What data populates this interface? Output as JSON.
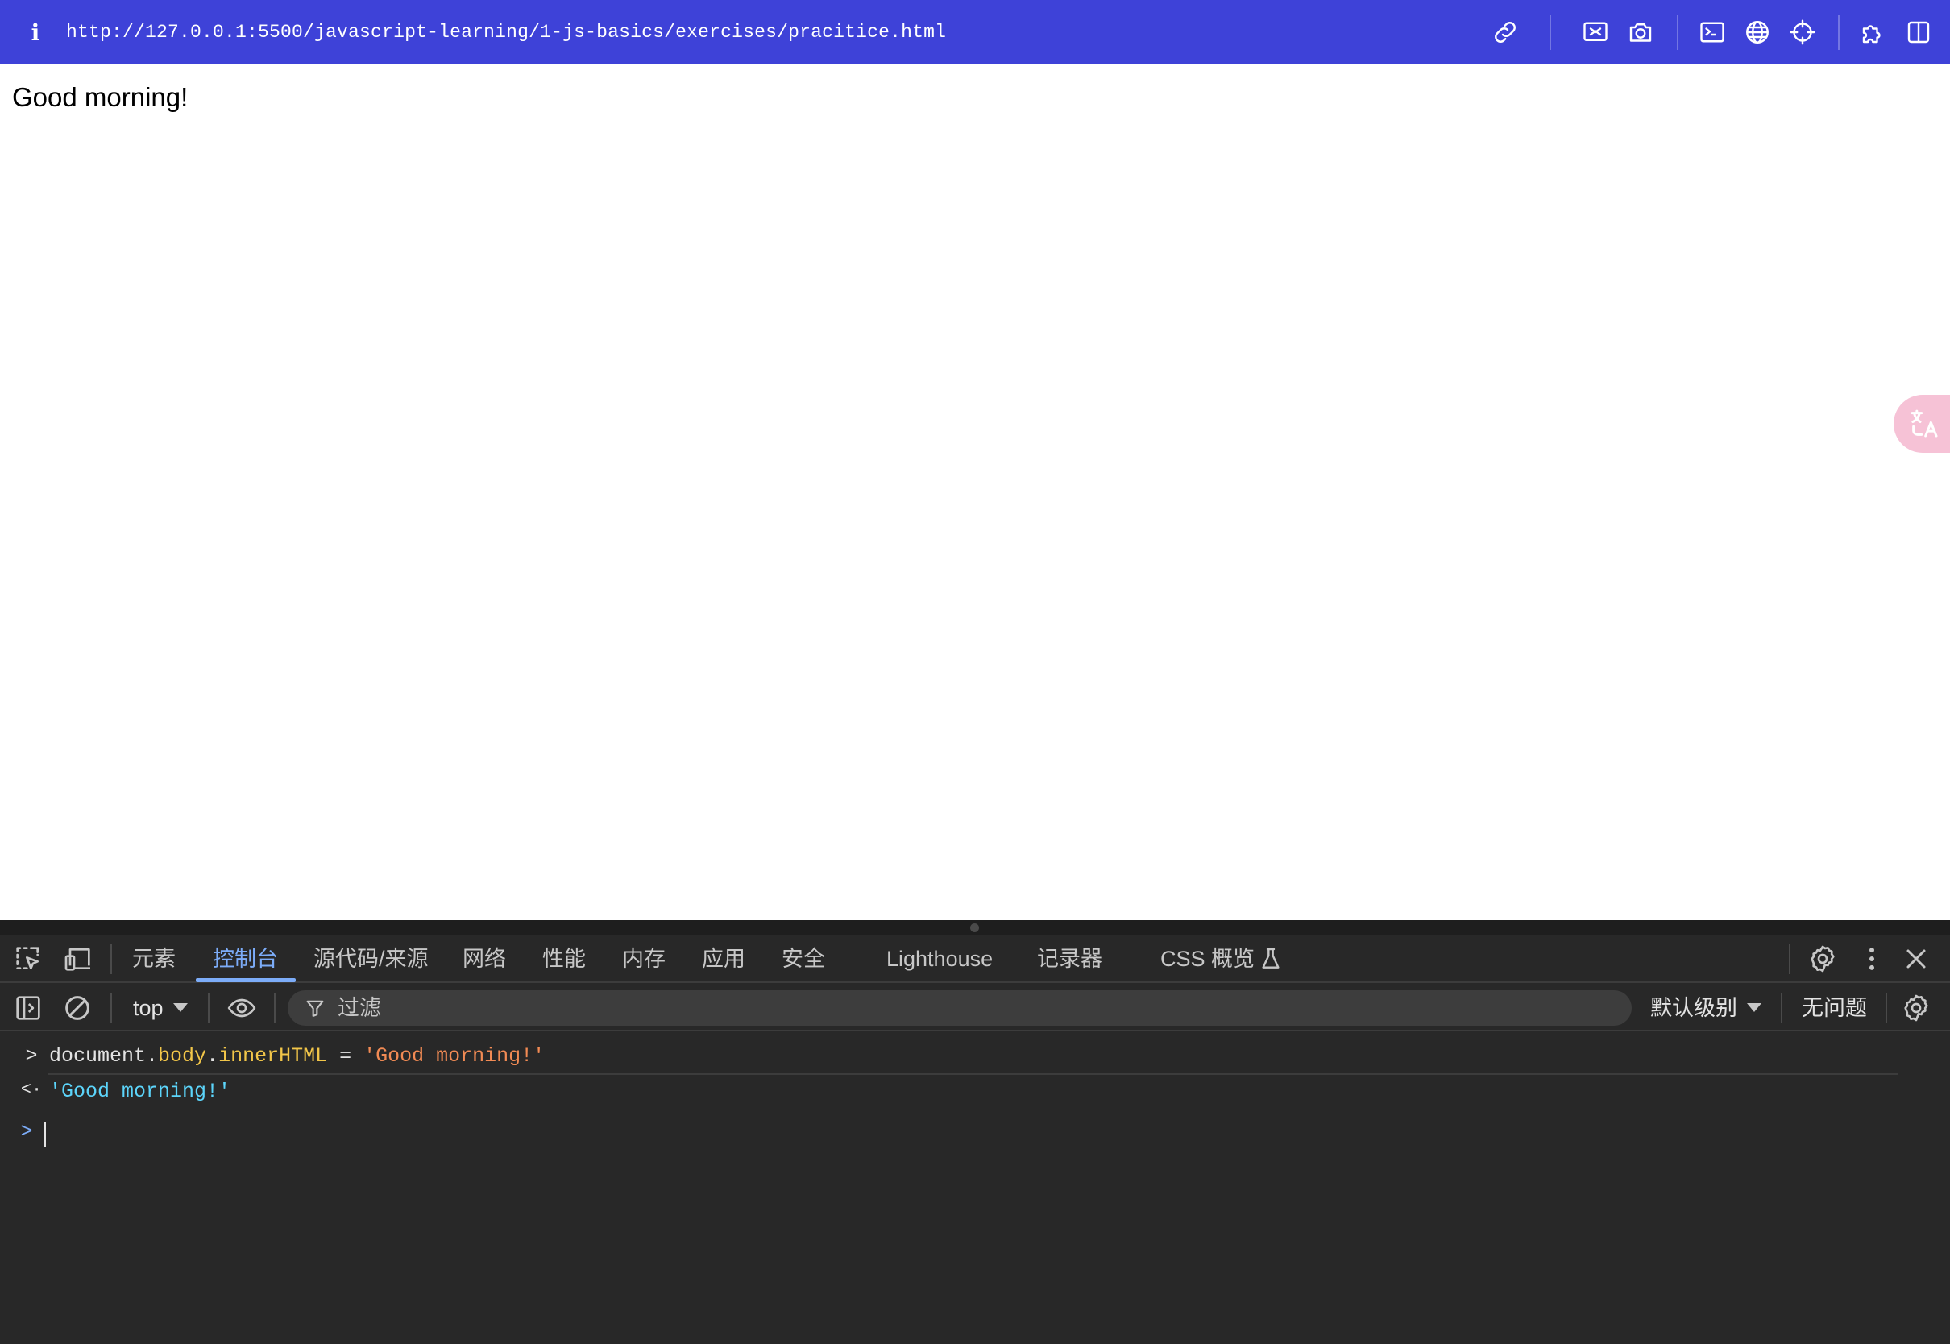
{
  "address_bar": {
    "info_glyph": "i",
    "url": "http://127.0.0.1:5500/javascript-learning/1-js-basics/exercises/pracitice.html",
    "tools": [
      "link-icon",
      "screen-share-icon",
      "camera-icon",
      "terminal-icon",
      "globe-icon",
      "crosshair-icon",
      "extension-icon",
      "split-view-icon"
    ]
  },
  "page": {
    "body_text": "Good morning!"
  },
  "devtools": {
    "tabs": [
      {
        "label": "元素"
      },
      {
        "label": "控制台",
        "active": true
      },
      {
        "label": "源代码/来源"
      },
      {
        "label": "网络"
      },
      {
        "label": "性能"
      },
      {
        "label": "内存"
      },
      {
        "label": "应用"
      },
      {
        "label": "安全"
      },
      {
        "label": "Lighthouse"
      },
      {
        "label": "记录器"
      },
      {
        "label": "CSS 概览"
      }
    ],
    "toolbar": {
      "context": "top",
      "filter_placeholder": "过滤",
      "level": "默认级别",
      "issues": "无问题"
    },
    "console": {
      "input": {
        "object": "document",
        "dot1": ".",
        "prop1": "body",
        "dot2": ".",
        "prop2": "innerHTML",
        "op": " = ",
        "string": "'Good morning!'"
      },
      "result": "'Good morning!'",
      "arrows": {
        "input": ">",
        "result": "<·",
        "prompt": ">"
      }
    },
    "colors": {
      "accent": "#7cacf8",
      "string": "#f28b54",
      "property": "#f2c649",
      "result": "#5cd5fb",
      "background": "#282828"
    }
  },
  "colors": {
    "address_bar_bg": "#3e42d8",
    "translate_button": "#f6c2d6"
  }
}
